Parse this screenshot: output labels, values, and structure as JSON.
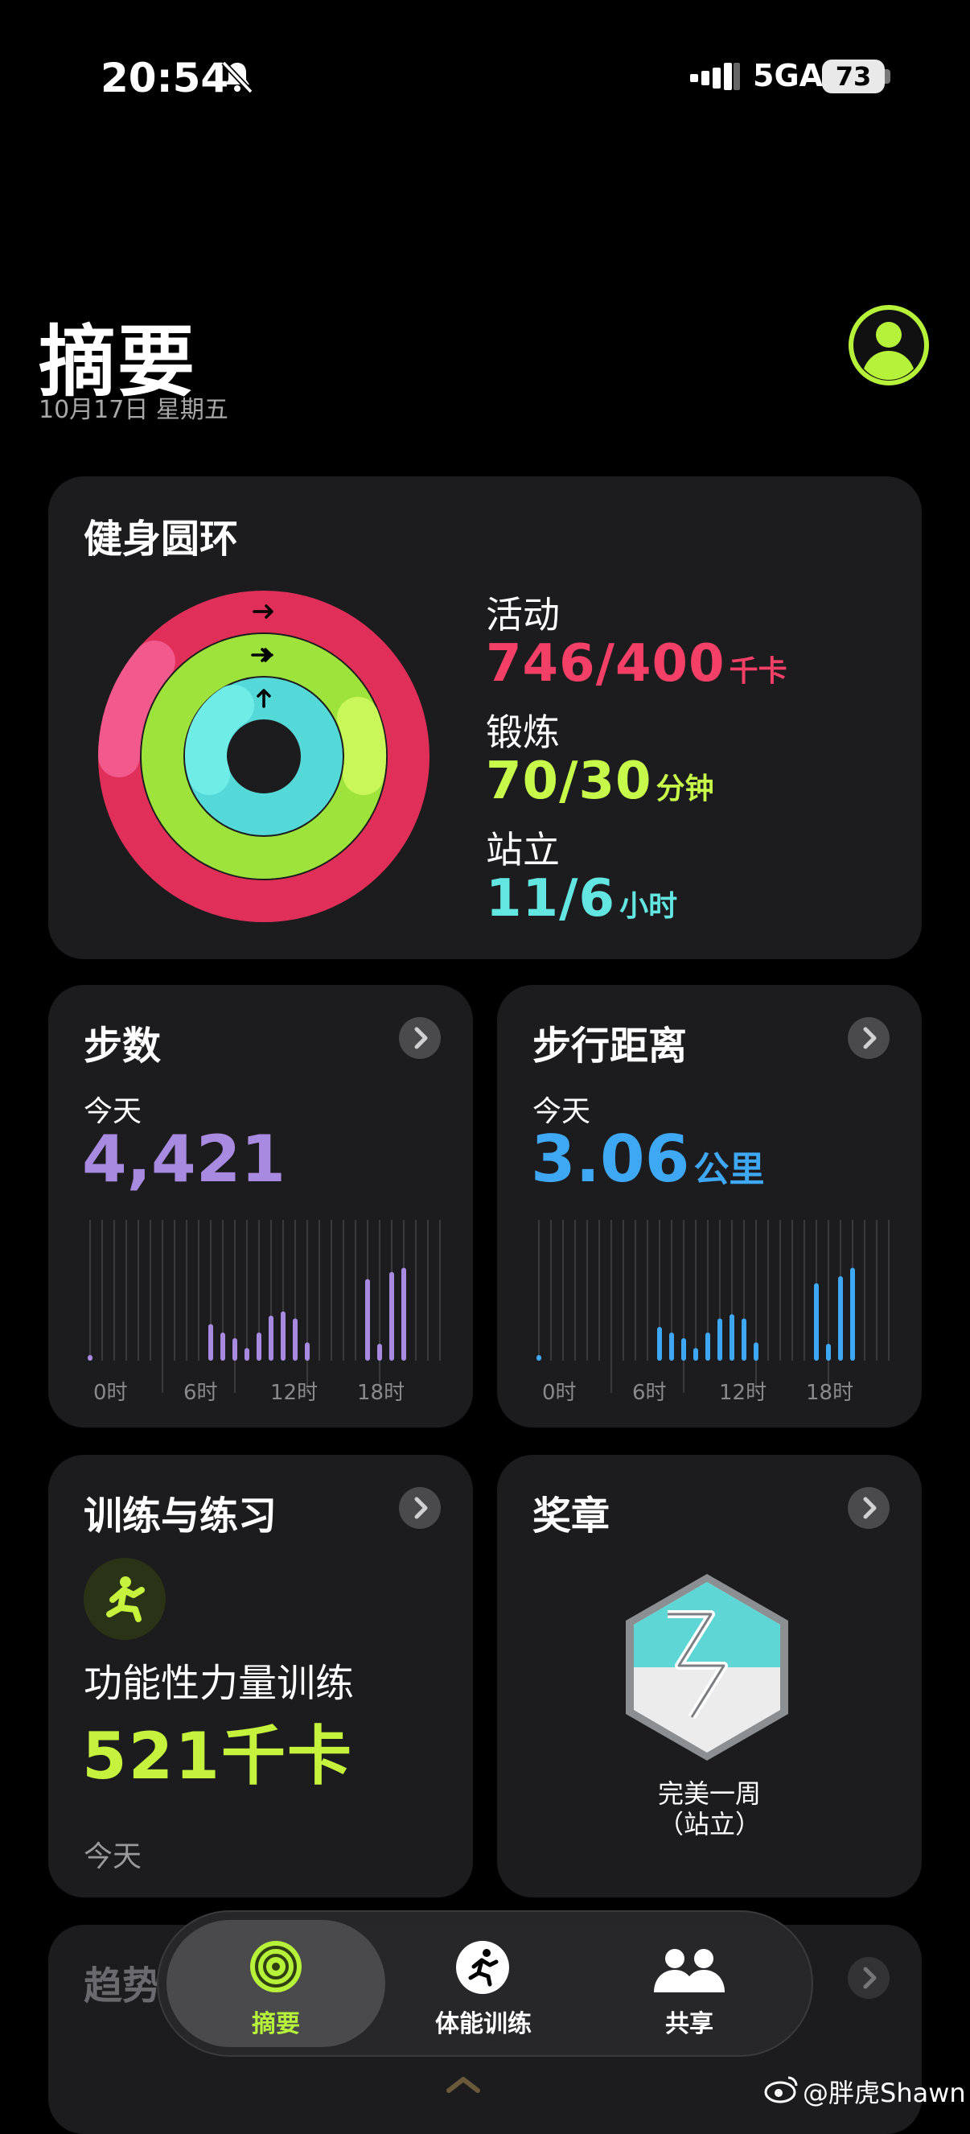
{
  "status_bar": {
    "time": "20:54",
    "network": "5GA",
    "battery": "73"
  },
  "header": {
    "title": "摘要",
    "date": "10月17日 星期五"
  },
  "rings": {
    "title": "健身圆环",
    "move": {
      "label": "活动",
      "value": "746/400",
      "unit": "千卡",
      "color": "#f43f66"
    },
    "exercise": {
      "label": "锻炼",
      "value": "70/30",
      "unit": "分钟",
      "color": "#c7f94a"
    },
    "stand": {
      "label": "站立",
      "value": "11/6",
      "unit": "小时",
      "color": "#63e6e2"
    }
  },
  "steps": {
    "title": "步数",
    "today": "今天",
    "value": "4,421",
    "color": "#a88ae0",
    "ticks": [
      "0时",
      "6时",
      "12时",
      "18时"
    ],
    "bars": [
      0.04,
      0,
      0,
      0,
      0,
      0,
      0,
      0,
      0,
      0,
      0.26,
      0.2,
      0.16,
      0.09,
      0.2,
      0.32,
      0.35,
      0.3,
      0.13,
      0,
      0,
      0,
      0,
      0.58,
      0.12,
      0.63,
      0.66,
      0,
      0,
      0
    ]
  },
  "distance": {
    "title": "步行距离",
    "today": "今天",
    "value": "3.06",
    "unit": "公里",
    "color": "#3fa8f5",
    "ticks": [
      "0时",
      "6时",
      "12时",
      "18时"
    ],
    "bars": [
      0.04,
      0,
      0,
      0,
      0,
      0,
      0,
      0,
      0,
      0,
      0.24,
      0.2,
      0.16,
      0.09,
      0.2,
      0.3,
      0.33,
      0.3,
      0.13,
      0,
      0,
      0,
      0,
      0.55,
      0.12,
      0.6,
      0.66,
      0,
      0,
      0
    ]
  },
  "workouts": {
    "title": "训练与练习",
    "name": "功能性力量训练",
    "kcal": "521千卡",
    "when": "今天"
  },
  "awards": {
    "title": "奖章",
    "badge_line1": "完美一周",
    "badge_line2": "（站立）"
  },
  "trends": {
    "title": "趋势"
  },
  "tabbar": {
    "tabs": [
      {
        "label": "摘要"
      },
      {
        "label": "体能训练"
      },
      {
        "label": "共享"
      }
    ]
  },
  "watermark": {
    "text": "@胖虎Shawn"
  }
}
